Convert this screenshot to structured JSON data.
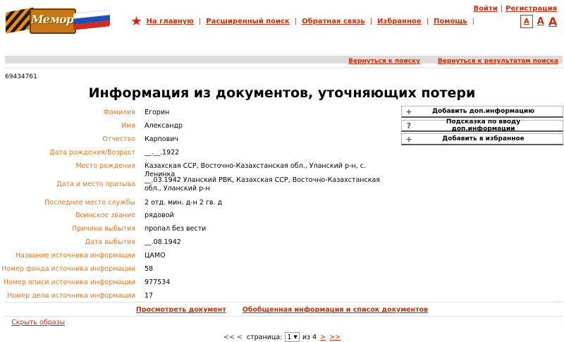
{
  "logo": {
    "text": "Мемориал"
  },
  "auth": {
    "login": "Войти",
    "register": "Регистрация"
  },
  "nav": {
    "home": "На главную",
    "advanced_search": "Расширенный поиск",
    "feedback": "Обратная связь",
    "favorites": "Избранное",
    "help": "Помощь"
  },
  "font_sizes": {
    "small": "А",
    "medium": "А",
    "large": "А"
  },
  "sub_nav": {
    "back_to_search": "Вернуться к поиску",
    "back_to_results": "Вернуться к результатам поиска"
  },
  "record_id": "69434761",
  "page_title": "Информация из документов, уточняющих потери",
  "fields": [
    {
      "label": "Фамилия",
      "value": "Егорин"
    },
    {
      "label": "Имя",
      "value": "Александр"
    },
    {
      "label": "Отчество",
      "value": "Карпович"
    },
    {
      "label": "Дата рождения/Возраст",
      "value": "__.__.1922"
    },
    {
      "label": "Место рождения",
      "value": "Казахская ССР, Восточно-Казахстанская обл., Уланский р-н, с. Ленинка"
    },
    {
      "label": "Дата и место призыва",
      "value": "__.03.1942 Уланский РВК, Казахская ССР, Восточно-Казахстанская обл., Уланский р-н"
    },
    {
      "label": "Последнее место службы",
      "value": "2 отд. мин. д-н 2 гв. д"
    },
    {
      "label": "Воинское звание",
      "value": "рядовой"
    },
    {
      "label": "Причина выбытия",
      "value": "пропал без вести"
    },
    {
      "label": "Дата выбытия",
      "value": "__.08.1942"
    },
    {
      "label": "Название источника информации",
      "value": "ЦАМО"
    },
    {
      "label": "Номер фонда источника информации",
      "value": "58"
    },
    {
      "label": "Номер описи источника информации",
      "value": "977534"
    },
    {
      "label": "Номер дела источника информации",
      "value": "17"
    }
  ],
  "actions": [
    {
      "glyph": "+",
      "label": "Добавить доп.информацию"
    },
    {
      "glyph": "?",
      "label": "Подсказка по вводу доп.информации"
    },
    {
      "glyph": "+",
      "label": "Добавить в избранное"
    }
  ],
  "doc_links": {
    "view_document": "Просмотреть документ",
    "summary": "Обобщенная информация и список документов"
  },
  "hide_images": "Скрыть образы",
  "pager": {
    "first_prev": "<< <",
    "page_label": "страница:",
    "current_page": "1",
    "of_total": "из 4",
    "next": ">",
    "last": ">>"
  },
  "colors": {
    "accent": "#c3320c",
    "label": "#e8781e",
    "bar": "#dcdcdc"
  }
}
